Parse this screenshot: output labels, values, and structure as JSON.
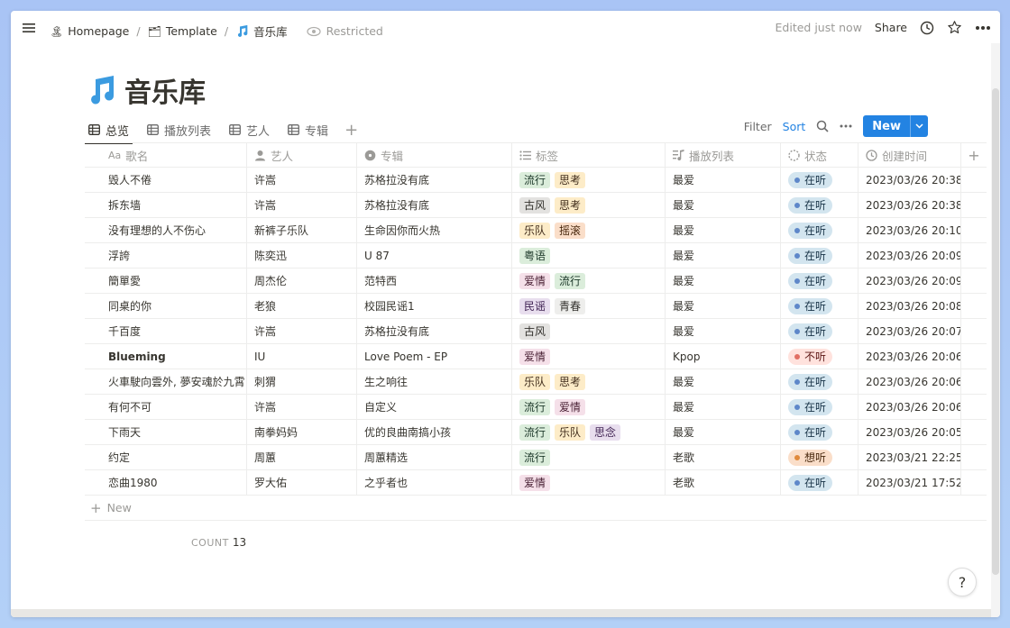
{
  "topbar": {
    "breadcrumbs": [
      {
        "emoji": "🏝️",
        "label": "Homepage"
      },
      {
        "emoji": "🗂️",
        "label": "Template"
      },
      {
        "emoji": "🎵",
        "label": "音乐库"
      }
    ],
    "restricted_label": "Restricted",
    "edited_label": "Edited just now",
    "share_label": "Share"
  },
  "page": {
    "title": "音乐库",
    "title_icon": "music-note-icon"
  },
  "views": {
    "tabs": [
      "总览",
      "播放列表",
      "艺人",
      "专辑"
    ],
    "active_index": 0,
    "filter_label": "Filter",
    "sort_label": "Sort",
    "new_label": "New"
  },
  "table": {
    "headers": [
      "歌名",
      "艺人",
      "专辑",
      "标签",
      "播放列表",
      "状态",
      "创建时间"
    ],
    "header_icons": [
      "text-icon",
      "person-icon",
      "album-icon",
      "list-icon",
      "playlist-icon",
      "status-icon",
      "clock-icon"
    ],
    "rows": [
      {
        "song": "毁人不倦",
        "artist": "许嵩",
        "album": "苏格拉没有底",
        "tags": [
          "流行",
          "思考"
        ],
        "playlist": "最爱",
        "status": "在听",
        "created": "2023/03/26 20:38"
      },
      {
        "song": "拆东墙",
        "artist": "许嵩",
        "album": "苏格拉没有底",
        "tags": [
          "古风",
          "思考"
        ],
        "playlist": "最爱",
        "status": "在听",
        "created": "2023/03/26 20:38"
      },
      {
        "song": "没有理想的人不伤心",
        "artist": "新裤子乐队",
        "album": "生命因你而火热",
        "tags": [
          "乐队",
          "摇滚"
        ],
        "playlist": "最爱",
        "status": "在听",
        "created": "2023/03/26 20:10"
      },
      {
        "song": "浮誇",
        "artist": "陈奕迅",
        "album": "U 87",
        "tags": [
          "粤语"
        ],
        "playlist": "最爱",
        "status": "在听",
        "created": "2023/03/26 20:09"
      },
      {
        "song": "簡單愛",
        "artist": "周杰伦",
        "album": "范特西",
        "tags": [
          "爱情",
          "流行"
        ],
        "playlist": "最爱",
        "status": "在听",
        "created": "2023/03/26 20:09"
      },
      {
        "song": "同桌的你",
        "artist": "老狼",
        "album": "校园民谣1",
        "tags": [
          "民谣",
          "青春"
        ],
        "playlist": "最爱",
        "status": "在听",
        "created": "2023/03/26 20:08"
      },
      {
        "song": "千百度",
        "artist": "许嵩",
        "album": "苏格拉没有底",
        "tags": [
          "古风"
        ],
        "playlist": "最爱",
        "status": "在听",
        "created": "2023/03/26 20:07"
      },
      {
        "song": "Blueming",
        "artist": "IU",
        "album": "Love Poem - EP",
        "tags": [
          "爱情"
        ],
        "playlist": "Kpop",
        "status": "不听",
        "created": "2023/03/26 20:06",
        "bold": true
      },
      {
        "song": "火車駛向雲外, 夢安魂於九霄",
        "artist": "刺猬",
        "album": "生之响往",
        "tags": [
          "乐队",
          "思考"
        ],
        "playlist": "最爱",
        "status": "在听",
        "created": "2023/03/26 20:06"
      },
      {
        "song": "有何不可",
        "artist": "许嵩",
        "album": "自定义",
        "tags": [
          "流行",
          "爱情"
        ],
        "playlist": "最爱",
        "status": "在听",
        "created": "2023/03/26 20:06"
      },
      {
        "song": "下雨天",
        "artist": "南拳妈妈",
        "album": "优的良曲南搞小孩",
        "tags": [
          "流行",
          "乐队",
          "思念"
        ],
        "playlist": "最爱",
        "status": "在听",
        "created": "2023/03/26 20:05"
      },
      {
        "song": "约定",
        "artist": "周蕙",
        "album": "周蕙精选",
        "tags": [
          "流行"
        ],
        "playlist": "老歌",
        "status": "想听",
        "created": "2023/03/21 22:25"
      },
      {
        "song": "恋曲1980",
        "artist": "罗大佑",
        "album": "之乎者也",
        "tags": [
          "爱情"
        ],
        "playlist": "老歌",
        "status": "在听",
        "created": "2023/03/21 17:52"
      }
    ],
    "new_row_label": "New",
    "count_label": "COUNT",
    "count_value": "13"
  },
  "tag_colors": {
    "流行": {
      "bg": "#dbeddb",
      "fg": "#1c3829"
    },
    "思考": {
      "bg": "#fdecc8",
      "fg": "#402c1b"
    },
    "古风": {
      "bg": "#e3e2e0",
      "fg": "#32302c"
    },
    "乐队": {
      "bg": "#fdecc8",
      "fg": "#402c1b"
    },
    "摇滚": {
      "bg": "#fadec9",
      "fg": "#49290e"
    },
    "粤语": {
      "bg": "#dbeddb",
      "fg": "#1c3829"
    },
    "爱情": {
      "bg": "#f5e0e9",
      "fg": "#4c2337"
    },
    "民谣": {
      "bg": "#e8deee",
      "fg": "#412454"
    },
    "青春": {
      "bg": "#eeeeec",
      "fg": "#32302c"
    },
    "思念": {
      "bg": "#e8deee",
      "fg": "#412454"
    }
  },
  "status_colors": {
    "在听": {
      "bg": "#d3e5ef",
      "dot": "#5e87c9",
      "fg": "#183347"
    },
    "不听": {
      "bg": "#ffe2dd",
      "dot": "#e16f64",
      "fg": "#5d1715"
    },
    "想听": {
      "bg": "#fadec9",
      "dot": "#e08a3c",
      "fg": "#49290e"
    }
  },
  "help_label": "?"
}
